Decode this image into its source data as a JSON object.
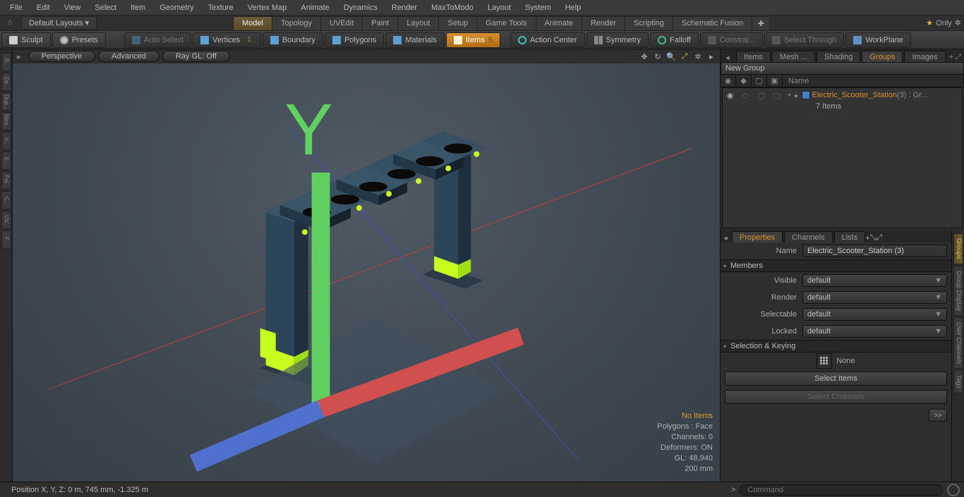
{
  "menubar": [
    "File",
    "Edit",
    "View",
    "Select",
    "Item",
    "Geometry",
    "Texture",
    "Vertex Map",
    "Animate",
    "Dynamics",
    "Render",
    "MaxToModo",
    "Layout",
    "System",
    "Help"
  ],
  "layout": {
    "home": "⌂",
    "default_layouts": "Default Layouts ▾",
    "tabs": [
      "Model",
      "Topology",
      "UVEdit",
      "Paint",
      "Layout",
      "Setup",
      "Game Tools",
      "Animate",
      "Render",
      "Scripting",
      "Schematic Fusion"
    ],
    "active_tab": "Model",
    "only": "Only"
  },
  "toolbar": {
    "sculpt": "Sculpt",
    "presets": "Presets",
    "autoselect": "Auto Select",
    "vertices": "Vertices",
    "vertices_n": "1",
    "boundary": "Boundary",
    "polygons": "Polygons",
    "materials": "Materials",
    "items": "Items",
    "items_n": "5",
    "action_center": "Action Center",
    "symmetry": "Symmetry",
    "falloff": "Falloff",
    "constraints": "Constrai...",
    "select_through": "Select Through",
    "workplane": "WorkPlane"
  },
  "leftstrip": [
    "B..",
    "De..",
    "Dup..",
    "Mes..",
    "V..",
    "E..",
    "Pol..",
    "C..",
    "UV..",
    "F.."
  ],
  "viewport_top": {
    "perspective": "Perspective",
    "advanced": "Advanced",
    "raygl": "Ray GL: Off"
  },
  "viewport_stats": {
    "no_items": "No Items",
    "polygons": "Polygons : Face",
    "channels": "Channels: 0",
    "deformers": "Deformers: ON",
    "gl": "GL: 48,940",
    "scale": "200 mm"
  },
  "right_tabs": [
    "Items",
    "Mesh ...",
    "Shading",
    "Groups",
    "Images"
  ],
  "right_active": "Groups",
  "outliner": {
    "new_group": "New Group",
    "name_hdr": "Name",
    "item": "Electric_Scooter_Station",
    "item_suffix": " (3) : Gr...",
    "subcount": "7 Items"
  },
  "prop_tabs": [
    "Properties",
    "Channels",
    "Lists"
  ],
  "prop_active": "Properties",
  "rightstrip": [
    "Groups",
    "Group Display",
    "User Channels",
    "Tags"
  ],
  "props": {
    "name_label": "Name",
    "name_value": "Electric_Scooter_Station (3)",
    "members": "Members",
    "visible": "Visible",
    "render": "Render",
    "selectable": "Selectable",
    "locked": "Locked",
    "default": "default",
    "selkey": "Selection & Keying",
    "none": "None",
    "select_items": "Select Items",
    "select_channels": "Select Channels",
    "go": ">>"
  },
  "status": {
    "pos": "Position X, Y, Z:   0 m, 745 mm, -1.325 m",
    "command_ph": "Command"
  }
}
